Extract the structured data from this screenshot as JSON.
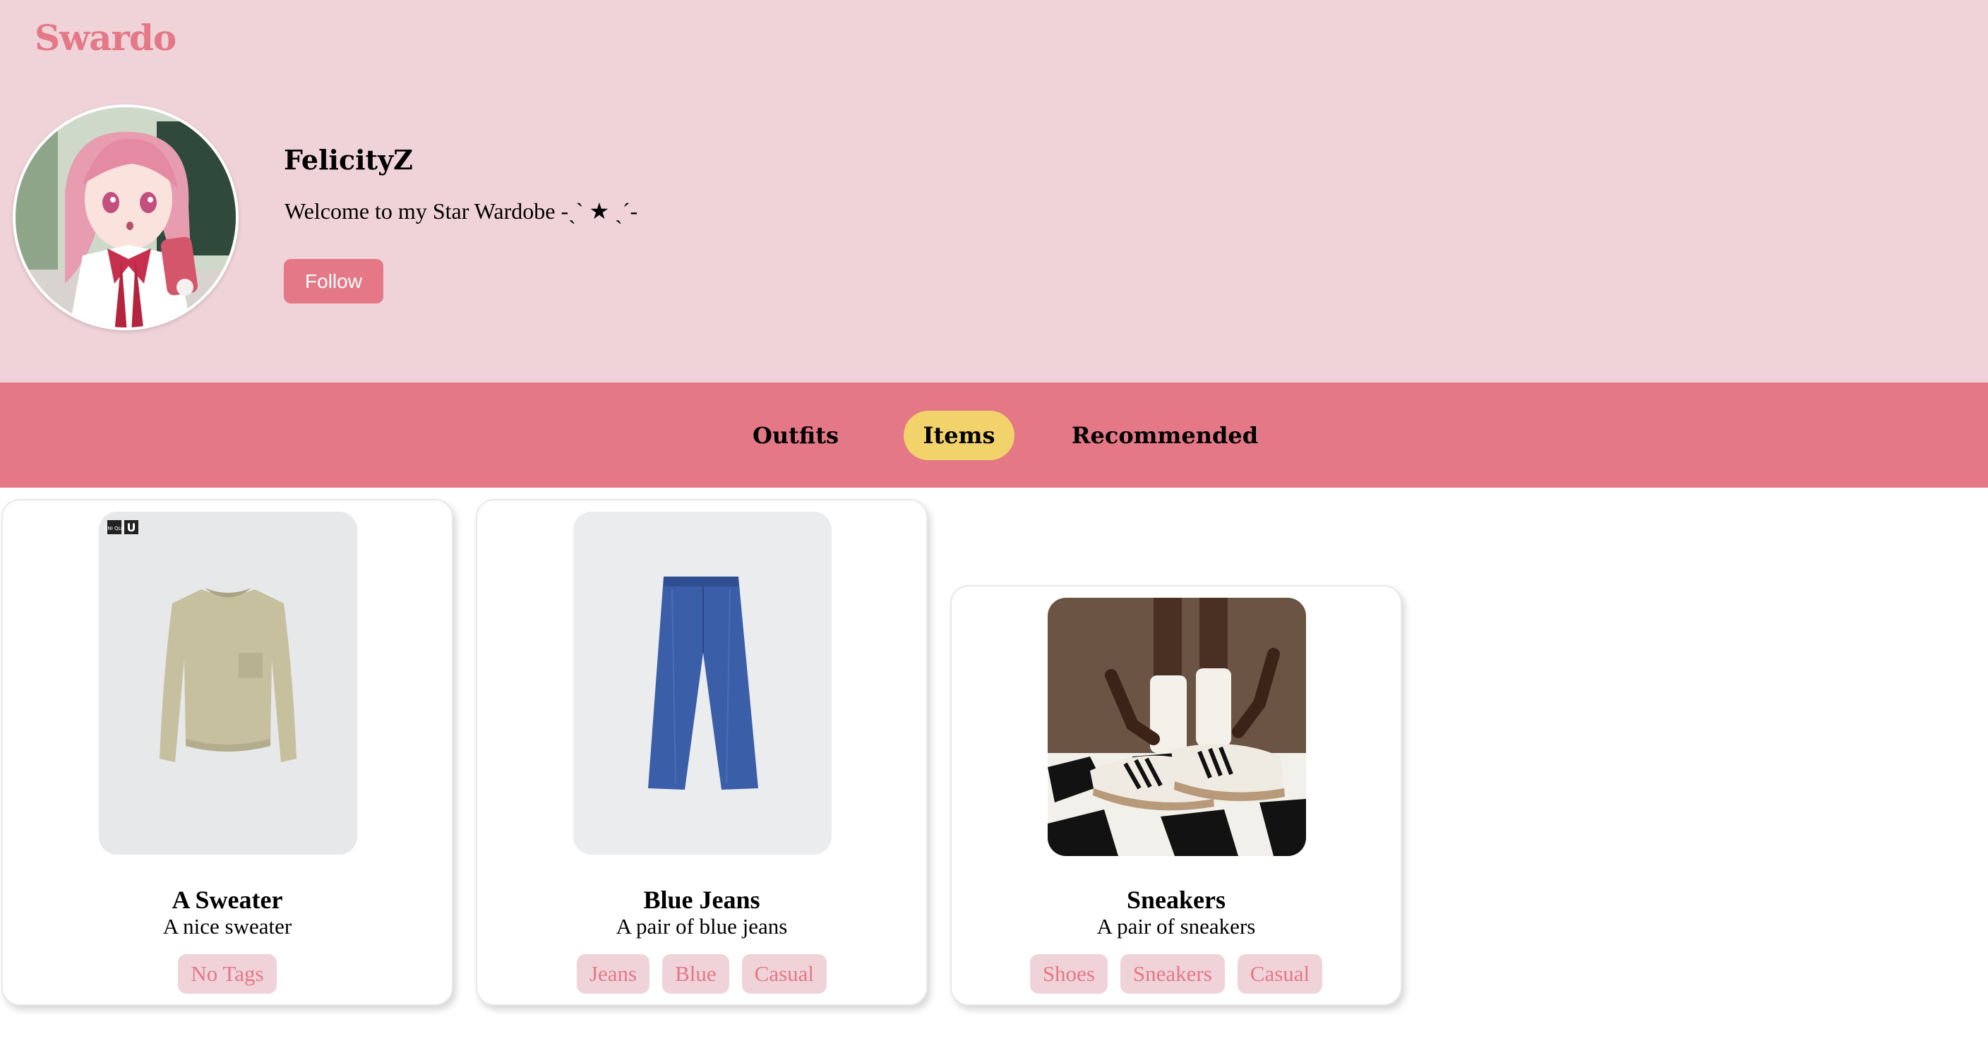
{
  "app": {
    "logo": "Swardo"
  },
  "profile": {
    "username": "FelicityZ",
    "bio": "Welcome to my Star Wardobe -ˏˋ ★ ˎˊ-",
    "follow_label": "Follow",
    "avatar_icon": "anime-girl-avatar"
  },
  "tabs": [
    {
      "label": "Outfits",
      "active": false
    },
    {
      "label": "Items",
      "active": true
    },
    {
      "label": "Recommended",
      "active": false
    }
  ],
  "items": [
    {
      "name": "A Sweater",
      "description": "A nice sweater",
      "tags": [
        "No Tags"
      ],
      "image_icon": "sweater-image",
      "brand_badges": [
        "UNI QLO",
        "U"
      ]
    },
    {
      "name": "Blue Jeans",
      "description": "A pair of blue jeans",
      "tags": [
        "Jeans",
        "Blue",
        "Casual"
      ],
      "image_icon": "jeans-image"
    },
    {
      "name": "Sneakers",
      "description": "A pair of sneakers",
      "tags": [
        "Shoes",
        "Sneakers",
        "Casual"
      ],
      "image_icon": "sneakers-image"
    }
  ],
  "colors": {
    "header_bg": "#efd3d8",
    "accent": "#e47886",
    "active_tab": "#f2d36b",
    "tag_bg": "#efd3d8"
  }
}
